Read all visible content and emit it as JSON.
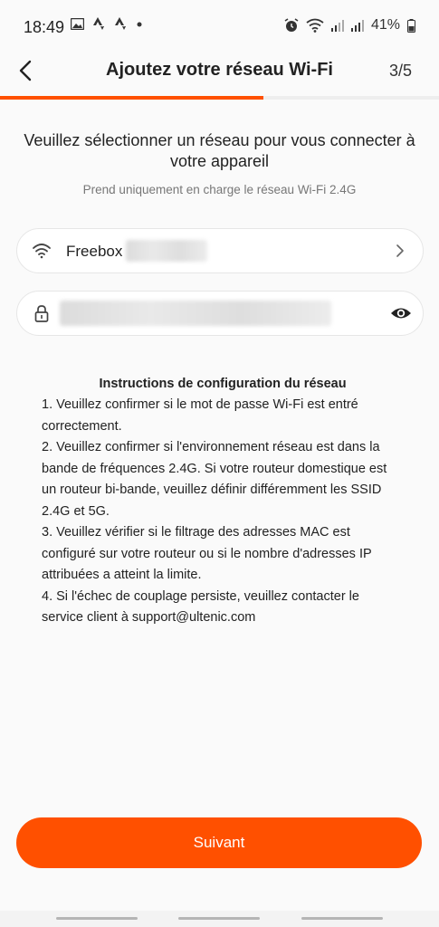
{
  "status_bar": {
    "time": "18:49",
    "battery": "41%",
    "left_icons": [
      "gallery-icon",
      "strava-icon",
      "strava-icon",
      "dot-icon"
    ],
    "right_icons": [
      "alarm-icon",
      "wifi-icon",
      "signal-icon",
      "signal-icon",
      "battery-icon"
    ]
  },
  "header": {
    "title": "Ajoutez votre réseau Wi-Fi",
    "step": "3/5",
    "progress_fraction": 0.6
  },
  "main": {
    "prompt": "Veuillez sélectionner un réseau pour vous connecter à votre appareil",
    "note": "Prend uniquement en charge le réseau Wi-Fi 2.4G",
    "wifi_field": {
      "ssid": "Freebox"
    },
    "instructions": {
      "title": "Instructions de configuration du réseau",
      "items": [
        "1. Veuillez confirmer si le mot de passe Wi-Fi est entré correctement.",
        "2. Veuillez confirmer si l'environnement réseau est dans la bande de fréquences 2.4G. Si votre routeur domestique est un routeur bi-bande, veuillez définir différemment les SSID 2.4G et 5G.",
        "3. Veuillez vérifier si le filtrage des adresses MAC est configuré sur votre routeur ou si le nombre d'adresses IP attribuées a atteint la limite.",
        "4. Si l'échec de couplage persiste, veuillez contacter le service client à support@ultenic.com"
      ]
    },
    "next_label": "Suivant"
  },
  "colors": {
    "accent": "#ff5000",
    "background": "#fafafa",
    "field_border": "#e6e6e6"
  }
}
